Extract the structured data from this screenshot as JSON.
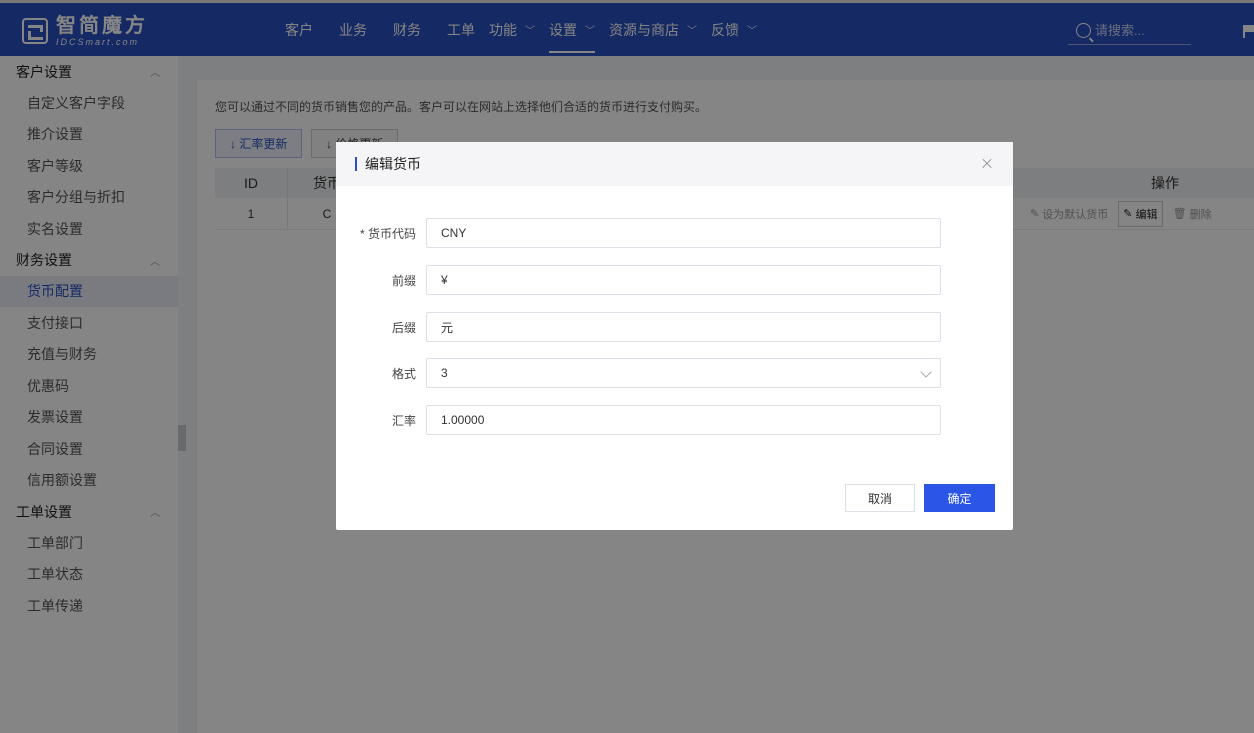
{
  "app": {
    "logo_cn": "智简魔方",
    "logo_en": "IDCSmart.com"
  },
  "nav": {
    "items": [
      {
        "label": "客户",
        "has_caret": false,
        "active": false
      },
      {
        "label": "业务",
        "has_caret": false,
        "active": false
      },
      {
        "label": "财务",
        "has_caret": false,
        "active": false
      },
      {
        "label": "工单",
        "has_caret": false,
        "active": false
      },
      {
        "label": "功能",
        "has_caret": true,
        "active": false
      },
      {
        "label": "设置",
        "has_caret": true,
        "active": true
      },
      {
        "label": "资源与商店",
        "has_caret": true,
        "active": false
      },
      {
        "label": "反馈",
        "has_caret": true,
        "active": false
      }
    ],
    "search_placeholder": "请搜索..."
  },
  "sidebar": {
    "groups": [
      {
        "label": "客户设置",
        "items": [
          "自定义客户字段",
          "推介设置",
          "客户等级",
          "客户分组与折扣",
          "实名设置"
        ]
      },
      {
        "label": "财务设置",
        "items": [
          "货币配置",
          "支付接口",
          "充值与财务",
          "优惠码",
          "发票设置",
          "合同设置",
          "信用额设置"
        ]
      },
      {
        "label": "工单设置",
        "items": [
          "工单部门",
          "工单状态",
          "工单传递"
        ]
      }
    ],
    "active_item": "货币配置"
  },
  "main": {
    "description": "您可以通过不同的货币销售您的产品。客户可以在网站上选择他们合适的货币进行支付购买。",
    "btn_rate_update": "↓ 汇率更新",
    "btn_price_update": "↓ 价格更新",
    "table": {
      "col_id": "ID",
      "col_currency": "货币",
      "col_ops": "操作",
      "row": {
        "id": "1",
        "currency": "C",
        "op_set_default": "设为默认货币",
        "op_edit": "编辑",
        "op_delete": "删除"
      }
    }
  },
  "modal": {
    "title": "编辑货币",
    "fields": {
      "code_label": "* 货币代码",
      "code_value": "CNY",
      "prefix_label": "前缀",
      "prefix_value": "¥",
      "suffix_label": "后缀",
      "suffix_value": "元",
      "format_label": "格式",
      "format_value": "3",
      "rate_label": "汇率",
      "rate_value": "1.00000"
    },
    "cancel": "取消",
    "confirm": "确定"
  }
}
